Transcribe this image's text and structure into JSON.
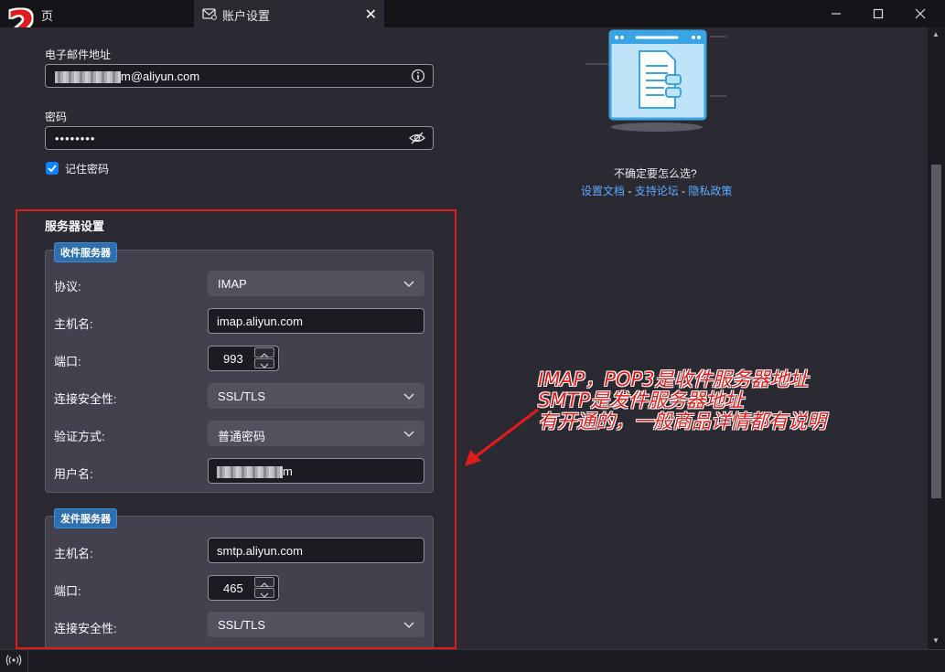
{
  "window": {
    "home_tab_label": "页",
    "step_number": "2",
    "active_tab_title": "账户设置",
    "close_tab_glyph": "✕"
  },
  "account": {
    "email_label": "电子邮件地址",
    "email_value_suffix": "m@aliyun.com",
    "password_label": "密码",
    "password_value": "••••••••",
    "remember_label": "记住密码",
    "remember_checked": true
  },
  "help": {
    "question": "不确定要怎么选?",
    "link_docs": "设置文档",
    "link_forum": "支持论坛",
    "link_privacy": "隐私政策",
    "separator": " - "
  },
  "server_settings": {
    "title": "服务器设置",
    "incoming": {
      "badge": "收件服务器",
      "protocol_label": "协议:",
      "protocol_value": "IMAP",
      "hostname_label": "主机名:",
      "hostname_value": "imap.aliyun.com",
      "port_label": "端口:",
      "port_value": "993",
      "security_label": "连接安全性:",
      "security_value": "SSL/TLS",
      "auth_label": "验证方式:",
      "auth_value": "普通密码",
      "username_label": "用户名:",
      "username_value_suffix": "m"
    },
    "outgoing": {
      "badge": "发件服务器",
      "hostname_label": "主机名:",
      "hostname_value": "smtp.aliyun.com",
      "port_label": "端口:",
      "port_value": "465",
      "security_label": "连接安全性:",
      "security_value": "SSL/TLS"
    }
  },
  "annotation": {
    "line1": "IMAP，POP3是收件服务器地址",
    "line2": "SMTP是发件服务器地址",
    "line3": "有开通的，一般商品详情都有说明"
  },
  "colors": {
    "accent": "#0a84ff",
    "annotation_red": "#e01b1b",
    "link_blue": "#5ea8ff"
  }
}
